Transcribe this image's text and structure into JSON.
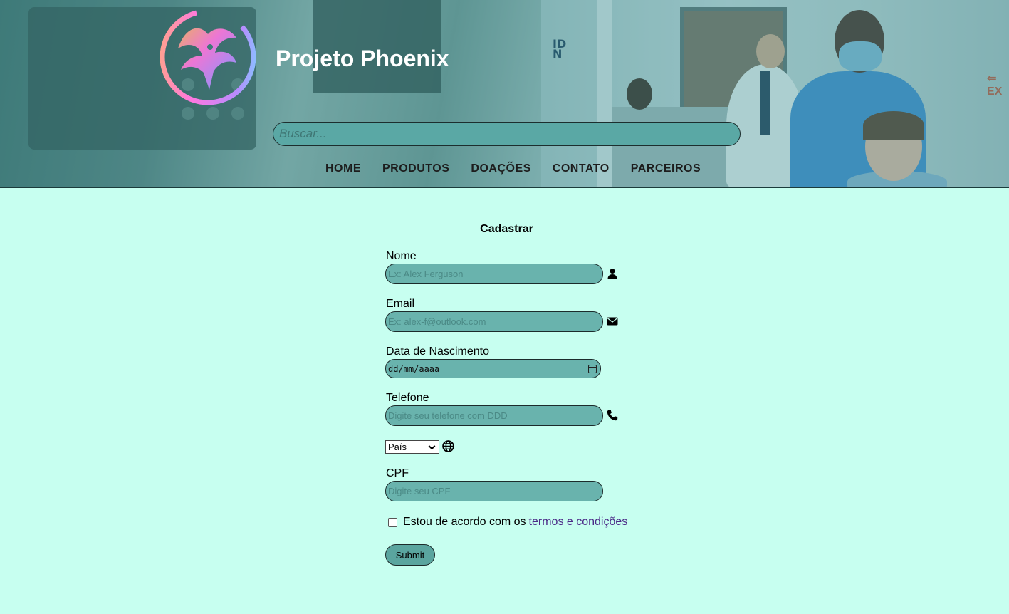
{
  "header": {
    "title": "Projeto Phoenix",
    "search_placeholder": "Buscar...",
    "nav": [
      "HOME",
      "PRODUTOS",
      "DOAÇÕES",
      "CONTATO",
      "PARCEIROS"
    ],
    "bg_sign": "ID\nN",
    "bg_exit": "⇐ EX"
  },
  "form": {
    "title": "Cadastrar",
    "nome_label": "Nome",
    "nome_placeholder": "Ex: Alex Ferguson",
    "email_label": "Email",
    "email_placeholder": "Ex: alex-f@outlook.com",
    "nascimento_label": "Data de Nascimento",
    "nascimento_placeholder": "dd/mm/aaaa",
    "telefone_label": "Telefone",
    "telefone_placeholder": "Digite seu telefone com DDD",
    "pais_selected": "País",
    "cpf_label": "CPF",
    "cpf_placeholder": "Digite seu CPF",
    "terms_text": "Estou de acordo com os",
    "terms_link": "termos e condições",
    "submit_label": "Submit"
  },
  "colors": {
    "page_bg": "#c7fff0",
    "input_bg": "#69b3ad",
    "link": "#4b2a87"
  },
  "icons": {
    "nome": "user-icon",
    "email": "envelope-icon",
    "telefone": "phone-icon",
    "pais": "globe-icon",
    "nascimento": "calendar-icon"
  }
}
